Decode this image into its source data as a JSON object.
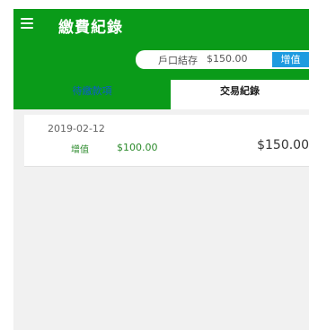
{
  "appbar": {
    "title": "繳費紀錄"
  },
  "balance": {
    "label": "戶口結存",
    "value": "$150.00",
    "topup_label": "增值"
  },
  "tabs": [
    {
      "label": "待繳款項",
      "active": false
    },
    {
      "label": "交易紀錄",
      "active": true
    }
  ],
  "records": [
    {
      "date": "2019-02-12",
      "type": "增值",
      "amount": "$100.00",
      "balance": "$150.00"
    }
  ],
  "colors": {
    "primary_green": "#0a9b19",
    "topup_blue": "#1e9be0",
    "positive_green": "#2b8a2b"
  },
  "icons": {
    "menu": "menu-icon"
  }
}
